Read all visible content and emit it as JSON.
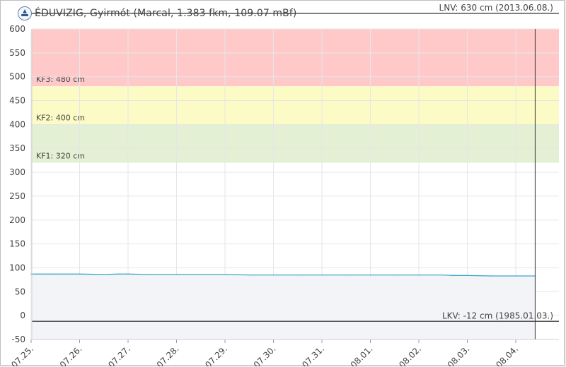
{
  "header": {
    "title": "ÉDUVIZIG, Gyirmót (Marcal, 1.383 fkm, 109.07 mBf)",
    "logo_icon": "eduvizig-logo-icon"
  },
  "chart_data": {
    "type": "line",
    "title": "ÉDUVIZIG, Gyirmót (Marcal, 1.383 fkm, 109.07 mBf)",
    "xlabel": "",
    "ylabel": "",
    "ylim": [
      -50,
      600
    ],
    "yticks": [
      600,
      550,
      500,
      450,
      400,
      350,
      300,
      250,
      200,
      150,
      100,
      50,
      0,
      -50
    ],
    "xticks": [
      "07.25.",
      "07.26.",
      "07.27.",
      "07.28.",
      "07.29.",
      "07.30.",
      "07.31.",
      "08.01.",
      "08.02.",
      "08.03.",
      "08.04."
    ],
    "grid": true,
    "bands": [
      {
        "label": "KF3: 480 cm",
        "from": 480,
        "to": 600,
        "color": "#ffc9c9"
      },
      {
        "label": "KF2: 400 cm",
        "from": 400,
        "to": 480,
        "color": "#fdfbc5"
      },
      {
        "label": "KF1: 320 cm",
        "from": 320,
        "to": 400,
        "color": "#e3f0d3"
      }
    ],
    "reference_lines": [
      {
        "label": "LNV: 630 cm (2013.06.08.)",
        "value": 630
      },
      {
        "label": "LKV: -12 cm (1985.01.03.)",
        "value": -12
      }
    ],
    "series": [
      {
        "color": "#3aa6c9",
        "fill_color": "#f2f4f8",
        "x": [
          0,
          0.5,
          1,
          1.5,
          1.8,
          2,
          2.4,
          2.8,
          3,
          3.5,
          4,
          4.5,
          5,
          5.5,
          6,
          6.5,
          7,
          7.5,
          8,
          8.5,
          8.7,
          9,
          9.5,
          10,
          10.4
        ],
        "values": [
          87,
          87,
          87,
          86,
          87,
          87,
          86,
          86,
          86,
          86,
          86,
          85,
          85,
          85,
          85,
          85,
          85,
          85,
          85,
          85,
          84,
          84,
          83,
          83,
          83
        ]
      }
    ],
    "cursor_x": 10.4
  },
  "colors": {
    "background": "#ffffff",
    "frame": "#bdbdbd",
    "grid": "#e6e6e6",
    "text": "#444444",
    "reference_line": "#555555"
  }
}
